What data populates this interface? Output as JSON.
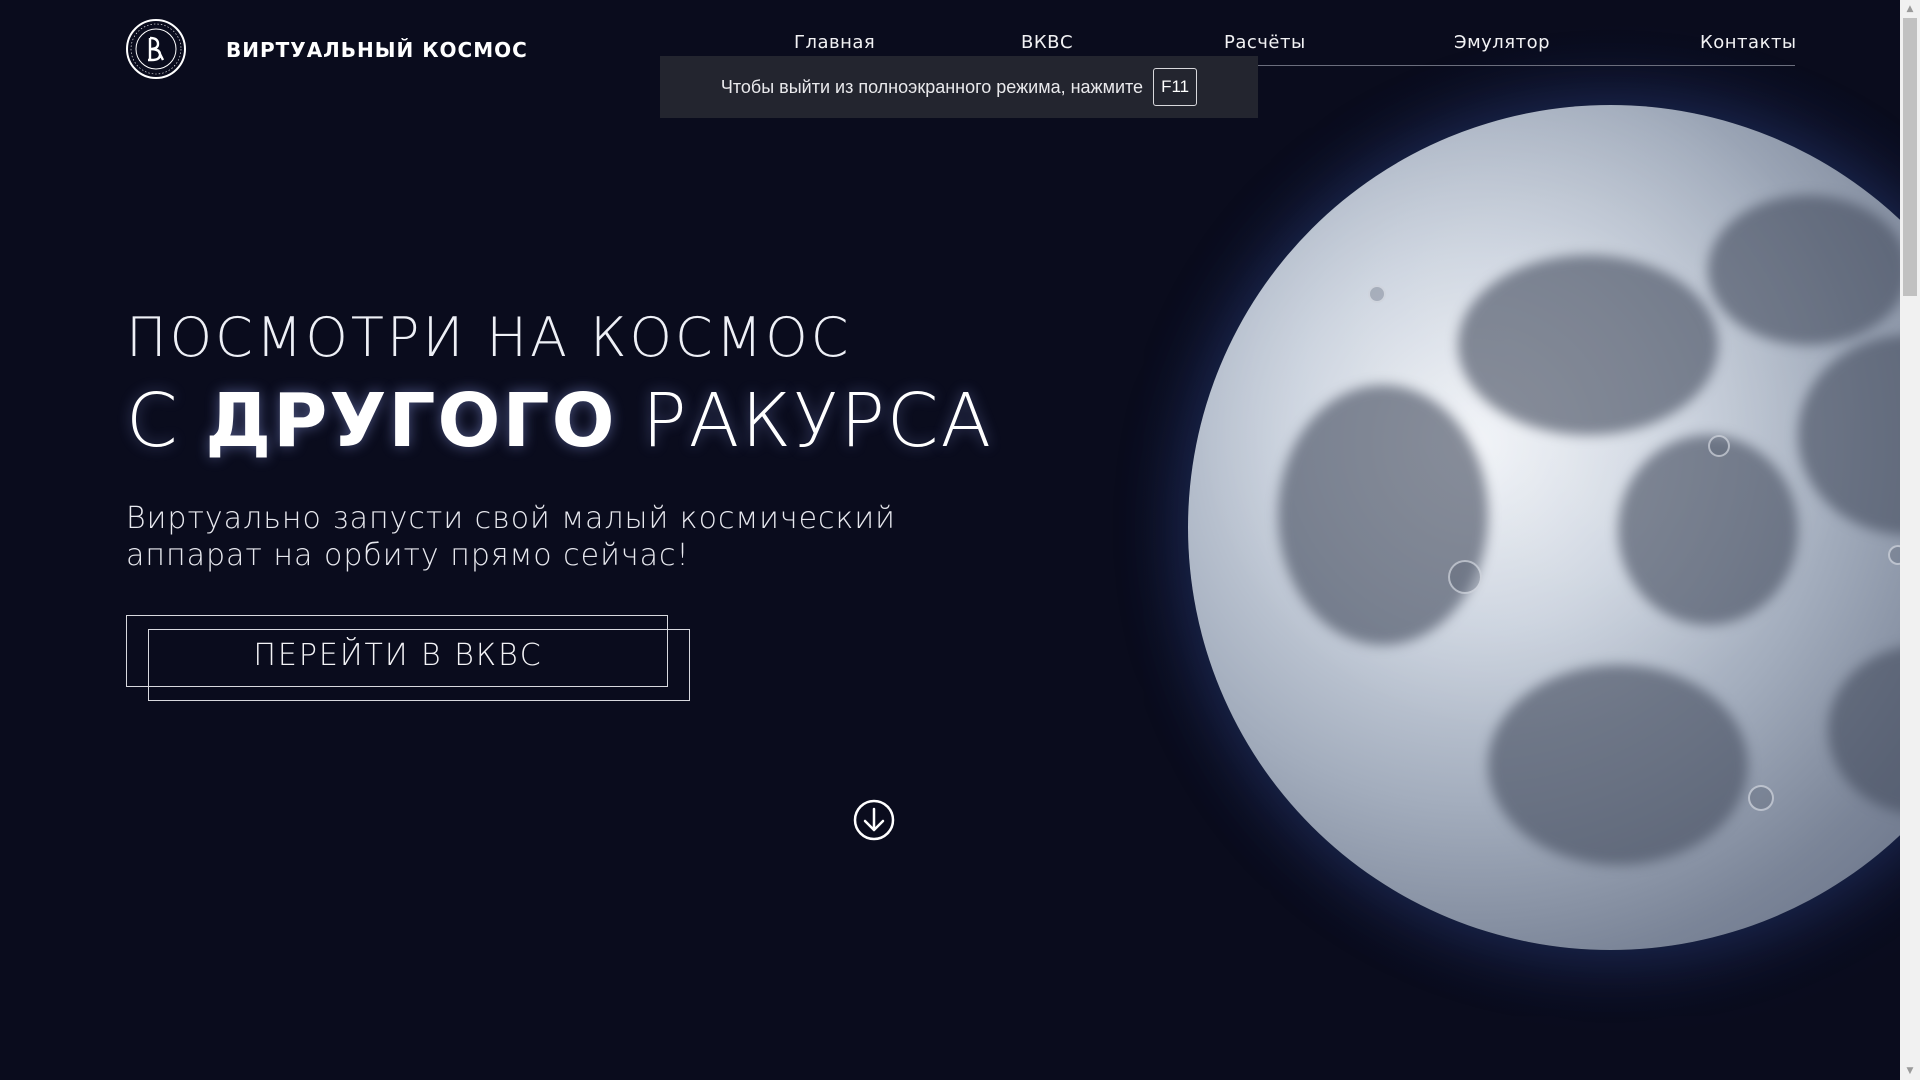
{
  "header": {
    "brand": "ВИРТУАЛЬНЫЙ КОСМОС",
    "logo_icon": "university-seal-icon",
    "nav": [
      {
        "label": "Главная"
      },
      {
        "label": "ВКВС"
      },
      {
        "label": "Расчёты"
      },
      {
        "label": "Эмулятор"
      },
      {
        "label": "Контакты"
      }
    ]
  },
  "fullscreen_hint": {
    "text": "Чтобы выйти из полноэкранного режима, нажмите",
    "key": "F11"
  },
  "hero": {
    "line1": "ПОСМОТРИ НА КОСМОС",
    "line2_prefix": "С ",
    "line2_strong": "ДРУГОГО",
    "line2_suffix": " РАКУРСА",
    "subtitle_line1": "Виртуально запусти свой малый космический",
    "subtitle_line2": "аппарат на орбиту прямо сейчас!",
    "cta_label": "ПЕРЕЙТИ В ВКВС",
    "scroll_icon": "arrow-down-circle-icon"
  },
  "colors": {
    "background": "#0a0c1d",
    "text": "#ffffff",
    "hint_background": "#23252f"
  }
}
